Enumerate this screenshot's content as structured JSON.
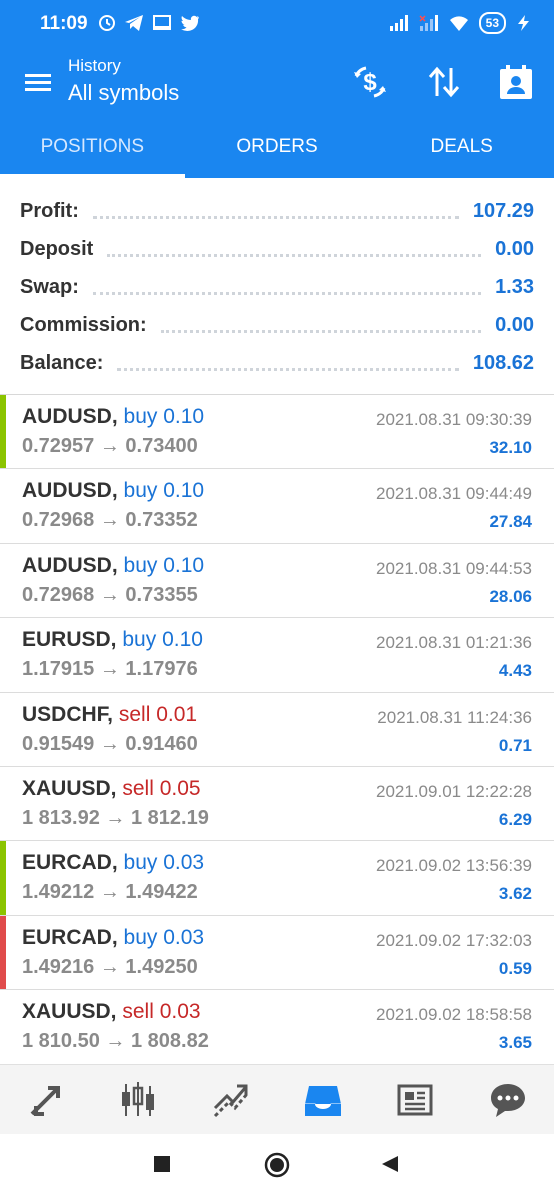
{
  "status_bar": {
    "time": "11:09",
    "battery": "53",
    "icons": [
      "clock-icon",
      "telegram-icon",
      "monitor-icon",
      "twitter-icon",
      "signal-icon",
      "signal-no-sim-icon",
      "wifi-icon",
      "charging-icon"
    ]
  },
  "app_bar": {
    "title_small": "History",
    "title_big": "All symbols",
    "icons": [
      "menu-icon",
      "currency-exchange-icon",
      "sort-icon",
      "calendar-icon"
    ]
  },
  "tabs": [
    {
      "label": "POSITIONS",
      "active": true
    },
    {
      "label": "ORDERS",
      "active": false
    },
    {
      "label": "DEALS",
      "active": false
    }
  ],
  "summary": [
    {
      "label": "Profit:",
      "value": "107.29"
    },
    {
      "label": "Deposit",
      "value": "0.00"
    },
    {
      "label": "Swap:",
      "value": "1.33"
    },
    {
      "label": "Commission:",
      "value": "0.00"
    },
    {
      "label": "Balance:",
      "value": "108.62"
    }
  ],
  "deals": [
    {
      "symbol": "AUDUSD,",
      "type": "buy",
      "volume": "0.10",
      "open": "0.72957",
      "close": "0.73400",
      "time": "2021.08.31 09:30:39",
      "profit": "32.10",
      "marker": "#8bc400"
    },
    {
      "symbol": "AUDUSD,",
      "type": "buy",
      "volume": "0.10",
      "open": "0.72968",
      "close": "0.73352",
      "time": "2021.08.31 09:44:49",
      "profit": "27.84",
      "marker": ""
    },
    {
      "symbol": "AUDUSD,",
      "type": "buy",
      "volume": "0.10",
      "open": "0.72968",
      "close": "0.73355",
      "time": "2021.08.31 09:44:53",
      "profit": "28.06",
      "marker": ""
    },
    {
      "symbol": "EURUSD,",
      "type": "buy",
      "volume": "0.10",
      "open": "1.17915",
      "close": "1.17976",
      "time": "2021.08.31 01:21:36",
      "profit": "4.43",
      "marker": ""
    },
    {
      "symbol": "USDCHF,",
      "type": "sell",
      "volume": "0.01",
      "open": "0.91549",
      "close": "0.91460",
      "time": "2021.08.31 11:24:36",
      "profit": "0.71",
      "marker": ""
    },
    {
      "symbol": "XAUUSD,",
      "type": "sell",
      "volume": "0.05",
      "open": "1 813.92",
      "close": "1 812.19",
      "time": "2021.09.01 12:22:28",
      "profit": "6.29",
      "marker": ""
    },
    {
      "symbol": "EURCAD,",
      "type": "buy",
      "volume": "0.03",
      "open": "1.49212",
      "close": "1.49422",
      "time": "2021.09.02 13:56:39",
      "profit": "3.62",
      "marker": "#8bc400"
    },
    {
      "symbol": "EURCAD,",
      "type": "buy",
      "volume": "0.03",
      "open": "1.49216",
      "close": "1.49250",
      "time": "2021.09.02 17:32:03",
      "profit": "0.59",
      "marker": "#e04b4b"
    },
    {
      "symbol": "XAUUSD,",
      "type": "sell",
      "volume": "0.03",
      "open": "1 810.50",
      "close": "1 808.82",
      "time": "2021.09.02 18:58:58",
      "profit": "3.65",
      "marker": ""
    }
  ],
  "arrow": "→",
  "bottom_nav": [
    {
      "icon": "quotes-icon",
      "active": false
    },
    {
      "icon": "chart-candles-icon",
      "active": false
    },
    {
      "icon": "trade-icon",
      "active": false
    },
    {
      "icon": "history-inbox-icon",
      "active": true
    },
    {
      "icon": "news-icon",
      "active": false
    },
    {
      "icon": "messages-icon",
      "active": false
    }
  ],
  "colors": {
    "primary": "#1a86f0",
    "buy": "#1a73d6",
    "sell": "#c62828",
    "profit": "#1a73d6"
  }
}
